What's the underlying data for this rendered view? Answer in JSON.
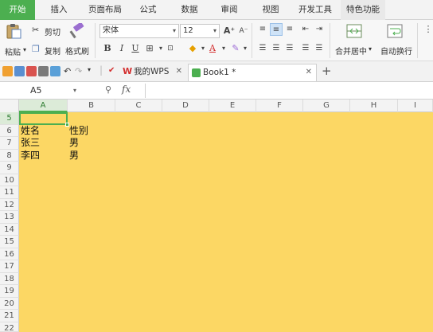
{
  "menu": {
    "tabs": [
      "开始",
      "插入",
      "页面布局",
      "公式",
      "数据",
      "审阅",
      "视图",
      "开发工具",
      "特色功能"
    ]
  },
  "ribbon": {
    "paste": "粘贴",
    "cut": "剪切",
    "copy": "复制",
    "format_painter": "格式刷",
    "font_name": "宋体",
    "font_size": "12",
    "bold": "B",
    "italic": "I",
    "underline": "U",
    "merge_center": "合并居中",
    "wrap_text": "自动换行"
  },
  "doc_tabs": {
    "home": "我的WPS",
    "book": "Book1 *"
  },
  "formula_bar": {
    "name_box": "A5",
    "fx": "fx",
    "value": ""
  },
  "grid": {
    "columns": [
      "A",
      "B",
      "C",
      "D",
      "E",
      "F",
      "G",
      "H",
      "I"
    ],
    "rows": [
      "5",
      "6",
      "7",
      "8",
      "9",
      "10",
      "11",
      "12",
      "13",
      "14",
      "15",
      "16",
      "17",
      "18",
      "19",
      "20",
      "21",
      "22"
    ],
    "cells": {
      "a6": "姓名",
      "b6": "性别",
      "a7": "张三",
      "b7": "男",
      "a8": "李四",
      "b8": "男"
    },
    "sheet_color": "#fcd764"
  },
  "colors": {
    "accent": "#4caf50"
  }
}
